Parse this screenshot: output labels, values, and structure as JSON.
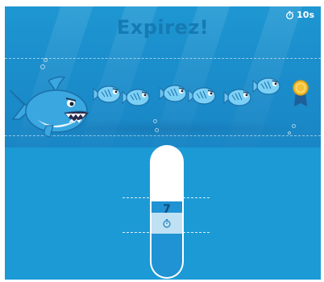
{
  "title": "Expirez!",
  "timer": {
    "icon": "stopwatch-icon",
    "text": "10s"
  },
  "breath_meter": {
    "value": "7",
    "icon": "stopwatch-icon",
    "fill_fraction": 0.58
  },
  "characters": {
    "shark": "shark-icon",
    "fish_count": 7,
    "goal": "medal-icon"
  },
  "colors": {
    "water": "#1c9ad6",
    "title": "#157ab3",
    "meter_fill": "#1f93d3",
    "meter_band": "#bfe1f3",
    "meter_text": "#124a7a"
  }
}
